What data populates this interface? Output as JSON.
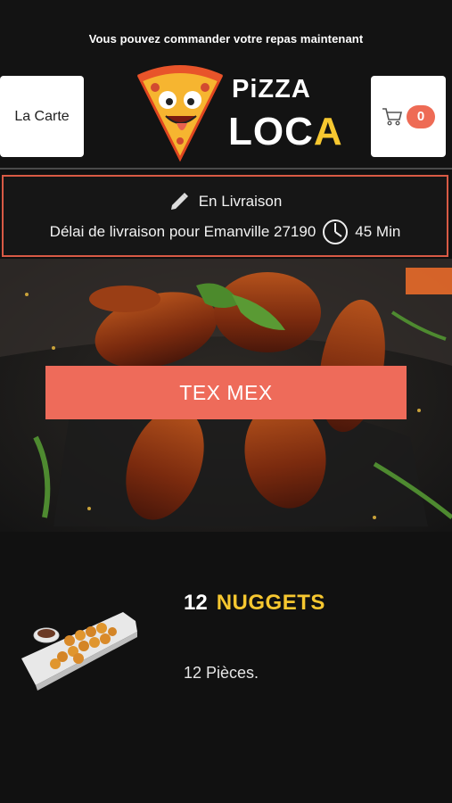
{
  "header": {
    "tagline": "Vous pouvez commander votre repas maintenant",
    "menu_button_label": "La Carte",
    "cart_count": "0",
    "logo": {
      "line1": "PiZZA",
      "line2_main": "LOC",
      "line2_accent": "A"
    }
  },
  "delivery": {
    "mode_label": "En Livraison",
    "delay_label": "Délai de livraison pour Emanville 27190",
    "delay_value": "45 Min"
  },
  "category": {
    "label": "TEX MEX"
  },
  "product": {
    "quantity": "12",
    "name": "NUGGETS",
    "description": "12 Pièces."
  },
  "colors": {
    "accent": "#ee6b5a",
    "yellow": "#f6c730",
    "background": "#111111"
  }
}
